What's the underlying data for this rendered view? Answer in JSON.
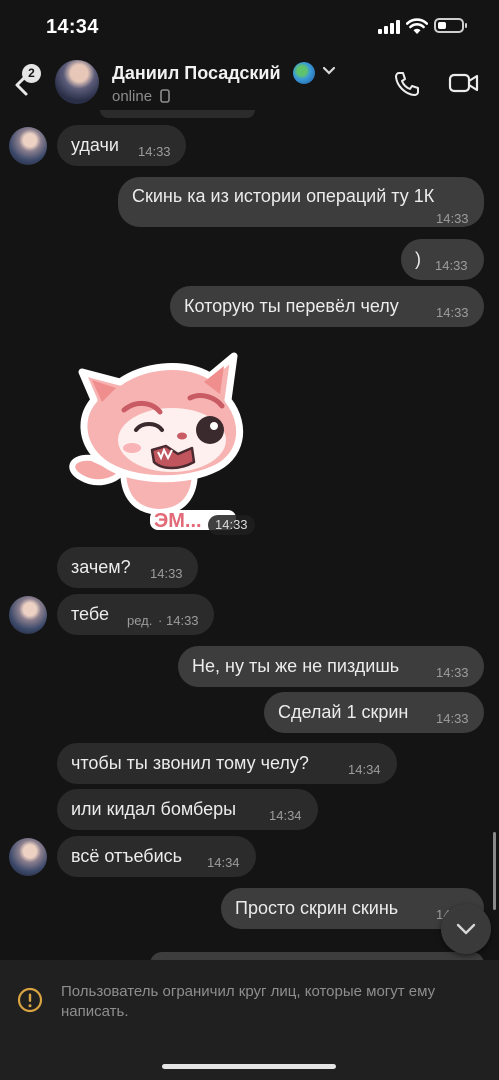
{
  "status_bar": {
    "time": "14:34"
  },
  "header": {
    "back_badge": "2",
    "contact_name": "Даниил Посадский",
    "presence": "online"
  },
  "messages": [
    {
      "id": "m1",
      "dir": "in",
      "text": "удачи",
      "time": "14:33"
    },
    {
      "id": "m2",
      "dir": "out",
      "text": "Скинь ка из истории операций ту 1К",
      "time": "14:33"
    },
    {
      "id": "m3",
      "dir": "out",
      "text": ")",
      "time": "14:33"
    },
    {
      "id": "m4",
      "dir": "out",
      "text": "Которую ты перевёл челу",
      "time": "14:33"
    },
    {
      "id": "m5",
      "dir": "out",
      "type": "sticker",
      "caption": "ЭМ...",
      "time": "14:33"
    },
    {
      "id": "m6",
      "dir": "in",
      "text": "зачем?",
      "time": "14:33"
    },
    {
      "id": "m7",
      "dir": "in",
      "text": "тебе",
      "edited": "ред.",
      "time": "14:33"
    },
    {
      "id": "m8",
      "dir": "out",
      "text": "Не, ну ты же не пиздишь",
      "time": "14:33"
    },
    {
      "id": "m9",
      "dir": "out",
      "text": "Сделай 1 скрин",
      "time": "14:33"
    },
    {
      "id": "m10",
      "dir": "in",
      "text": "чтобы ты звонил тому челу?",
      "time": "14:34"
    },
    {
      "id": "m11",
      "dir": "in",
      "text": "или кидал бомберы",
      "time": "14:34"
    },
    {
      "id": "m12",
      "dir": "in",
      "text": "всё отъебись",
      "time": "14:34"
    },
    {
      "id": "m13",
      "dir": "out",
      "text": "Просто скрин скинь",
      "time": "14"
    }
  ],
  "footer": {
    "notice": "Пользователь ограничил круг лиц, которые могут ему написать."
  },
  "icons": {
    "back": "chevron-left-icon",
    "call": "phone-icon",
    "video": "video-camera-icon",
    "warning": "warning-circle-icon",
    "scroll_down": "chevron-down-icon"
  },
  "colors": {
    "background": "#141414",
    "incoming_bubble": "#2b2b2b",
    "outgoing_bubble": "#3d3d3d",
    "warning": "#d9a441"
  }
}
